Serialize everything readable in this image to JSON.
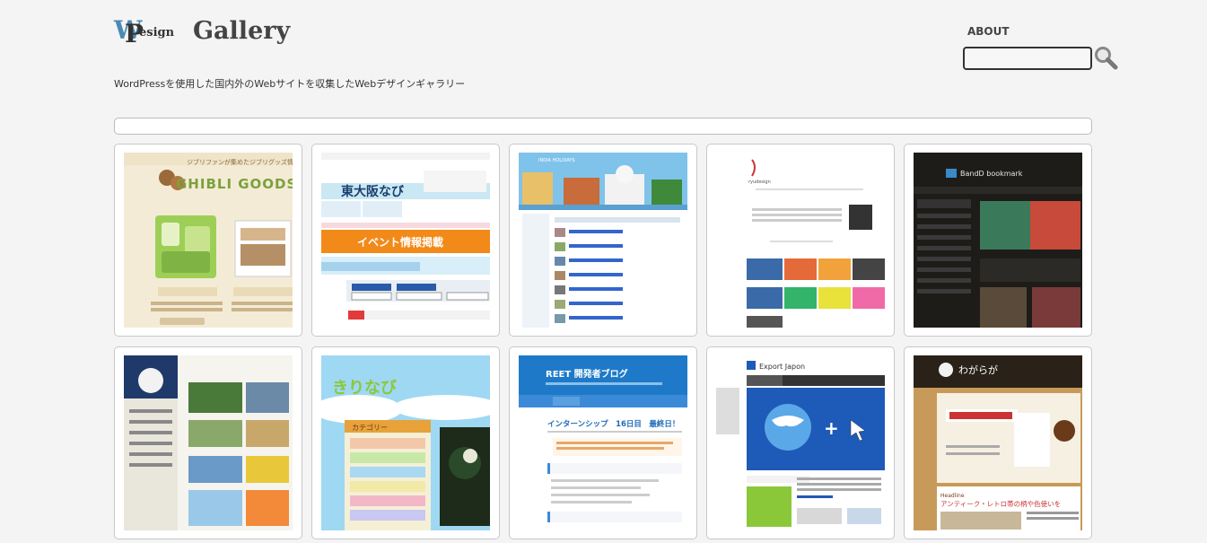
{
  "header": {
    "logo_w": "W",
    "logo_p": "P",
    "logo_design": "esign",
    "logo_gallery": "Gallery",
    "tagline": "WordPressを使用した国内外のWebサイトを収集したWebデザインギャラリー",
    "about_label": "ABOUT",
    "search_value": ""
  },
  "gallery": {
    "items": [
      {
        "title": "GHIBLI GOODS EN",
        "caption": "ジブリファンが集めたジブリグッズ情報"
      },
      {
        "title": "東大阪なび",
        "caption": "イベント情報掲載"
      },
      {
        "title": "INDIA HOLIDAYS",
        "caption": ""
      },
      {
        "title": "ryudesign",
        "caption": ""
      },
      {
        "title": "BandD bookmark",
        "caption": ""
      },
      {
        "title": "",
        "caption": ""
      },
      {
        "title": "きりなび",
        "caption": "カテゴリー"
      },
      {
        "title": "REET 開発者ブログ",
        "caption": "インターンシップ　16日目　最終日！"
      },
      {
        "title": "Export Japon",
        "caption": ""
      },
      {
        "title": "わがらが",
        "caption": "アンティーク・レトロ帯の柄や色使いを"
      }
    ]
  },
  "colors": {
    "logo_w": "#4a8ab3",
    "background": "#f4f4f4"
  }
}
